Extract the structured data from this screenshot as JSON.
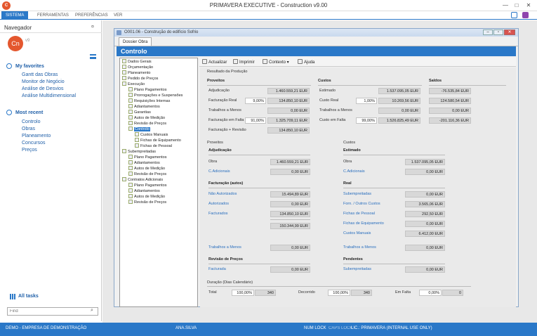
{
  "app": {
    "title": "PRIMAVERA EXECUTIVE - Construction v9.00",
    "logo": "C"
  },
  "menu": [
    "SISTEMA",
    "FERRAMENTAS",
    "PREFERÊNCIAS",
    "VER"
  ],
  "nav": {
    "title": "Navegador",
    "avatar": "Cn",
    "avatar_sup": "v9",
    "fav_title": "My favorites",
    "favorites": [
      "Gantt das Obras",
      "Monitor de Negócio",
      "Análise de Desvios",
      "Análise Multidimensional"
    ],
    "recent_title": "Most recent",
    "recent": [
      "Controlo",
      "Obras",
      "Planeamento",
      "Concursos",
      "Preços"
    ],
    "alltasks": "All tasks",
    "find_placeholder": "Find"
  },
  "status": {
    "company": "DEMO - EMPRESA DE DEMONSTRAÇÃO",
    "user": "ANA.SILVA",
    "numlock": "NUM LOCK",
    "capslock": "CAPS LOCK",
    "lic": "LIC.: PRIMAVERA (INTERNAL USE ONLY)"
  },
  "doc": {
    "title": "O001.06 - Construção do edifício Sofrio",
    "tab": "Dossier Obra",
    "banner": "Controlo"
  },
  "tree": [
    {
      "t": "Dados Gerais",
      "l": 0
    },
    {
      "t": "Orçamentação",
      "l": 0
    },
    {
      "t": "Planeamento",
      "l": 0
    },
    {
      "t": "Pedido de Preços",
      "l": 0
    },
    {
      "t": "Execução",
      "l": 0
    },
    {
      "t": "Plano Pagamentos",
      "l": 1
    },
    {
      "t": "Prorrogações e Suspensões",
      "l": 1
    },
    {
      "t": "Requisições Internas",
      "l": 1
    },
    {
      "t": "Adiantamentos",
      "l": 1
    },
    {
      "t": "Garantias",
      "l": 1
    },
    {
      "t": "Autos de Medição",
      "l": 1
    },
    {
      "t": "Revisão de Preços",
      "l": 1
    },
    {
      "t": "Controlo",
      "l": 1,
      "sel": true
    },
    {
      "t": "Custos Manuais",
      "l": 2
    },
    {
      "t": "Fichas de Equipamento",
      "l": 2
    },
    {
      "t": "Fichas de Pessoal",
      "l": 2
    },
    {
      "t": "Subempreitadas",
      "l": 0
    },
    {
      "t": "Plano Pagamentos",
      "l": 1
    },
    {
      "t": "Adiantamentos",
      "l": 1
    },
    {
      "t": "Autos de Medição",
      "l": 1
    },
    {
      "t": "Revisão de Preços",
      "l": 1
    },
    {
      "t": "Contratos Adicionais",
      "l": 0
    },
    {
      "t": "Plano Pagamentos",
      "l": 1
    },
    {
      "t": "Adiantamentos",
      "l": 1
    },
    {
      "t": "Autos de Medição",
      "l": 1
    },
    {
      "t": "Revisão de Preços",
      "l": 1
    }
  ],
  "toolbar": {
    "actualizar": "Actualizar",
    "imprimir": "Imprimir",
    "contexto": "Contexto",
    "ajuda": "Ajuda"
  },
  "resultado": {
    "title": "Resultado da Produção",
    "h_proveitos": "Proveitos",
    "h_custos": "Custos",
    "h_saldos": "Saldos",
    "rows": [
      {
        "pl": "Adjudicação",
        "pp": "",
        "pv": "1.460.559,21 EUR",
        "cl": "Estimado",
        "cp": "",
        "cv": "1.537.095,05 EUR",
        "s": "-76.535,84 EUR"
      },
      {
        "pl": "Facturação Real",
        "pp": "9,00%",
        "pv": "134.850,10 EUR",
        "cl": "Custo Real",
        "cp": "1,00%",
        "cv": "10.269,56 EUR",
        "s": "124.580,54 EUR"
      },
      {
        "pl": "Trabalhos a Menos",
        "pp": "",
        "pv": "0,00 EUR",
        "cl": "Trabalhos a Menos",
        "cp": "",
        "cv": "0,00 EUR",
        "s": "0,00 EUR"
      },
      {
        "pl": "Facturação em Falta",
        "pp": "91,00%",
        "pv": "1.325.709,11 EUR",
        "cl": "Custo em Falta",
        "cp": "99,00%",
        "cv": "1.526.825,49 EUR",
        "s": "-201.116,36 EUR"
      },
      {
        "pl": "Facturação + Revisão",
        "pp": "",
        "pv": "134.850,10 EUR",
        "cl": "",
        "cp": "",
        "cv": "",
        "s": ""
      }
    ]
  },
  "proveitos": {
    "title": "Proveitos",
    "adj_h": "Adjudicação",
    "obra": "Obra",
    "obra_v": "1.460.559,21 EUR",
    "cad": "C.Adicionais",
    "cad_v": "0,00 EUR",
    "fact_h": "Facturação (autos)",
    "naut": "Não Autorizados",
    "naut_v": "15.494,89 EUR",
    "aut": "Autorizados",
    "aut_v": "0,00 EUR",
    "fac": "Facturados",
    "fac_v": "134.850,10 EUR",
    "total_v": "150.344,99 EUR",
    "tm": "Trabalhos a Menos",
    "tm_v": "0,00 EUR",
    "rev_h": "Revisão de Preços",
    "factd": "Facturada",
    "factd_v": "0,00 EUR"
  },
  "custos": {
    "title": "Custos",
    "est_h": "Estimado",
    "obra": "Obra",
    "obra_v": "1.537.095,05 EUR",
    "cad": "C.Adicionais",
    "cad_v": "0,00 EUR",
    "real_h": "Real",
    "sub": "Subempreitadas",
    "sub_v": "0,00 EUR",
    "forn": "Forn. / Outros Custos",
    "forn_v": "3.565,06 EUR",
    "fp": "Fichas de Pessoal",
    "fp_v": "292,50 EUR",
    "fe": "Fichas de Equipamento",
    "fe_v": "0,00 EUR",
    "cm": "Custos Manuais",
    "cm_v": "6.412,00 EUR",
    "tm": "Trabalhos a Menos",
    "tm_v": "0,00 EUR",
    "pend_h": "Pendentes",
    "psub": "Subempreitadas",
    "psub_v": "0,00 EUR"
  },
  "duracao": {
    "title": "Duração (Dias Calendário)",
    "total": "Total",
    "tp": "100,00%",
    "tv": "340",
    "dec": "Decorrido",
    "dp": "100,00%",
    "dv": "340",
    "falta": "Em Falta",
    "fp": "0,00%",
    "fv": "0"
  }
}
